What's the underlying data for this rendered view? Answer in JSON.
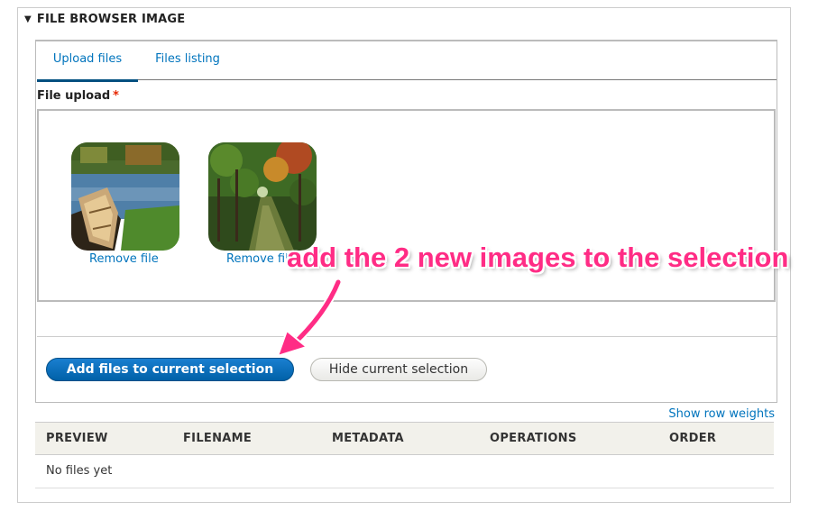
{
  "fieldset": {
    "title": "FILE BROWSER IMAGE"
  },
  "tabs": [
    {
      "label": "Upload files",
      "active": true
    },
    {
      "label": "Files listing",
      "active": false
    }
  ],
  "upload": {
    "label": "File upload",
    "required_marker": "*",
    "files": [
      {
        "thumbnail": "canoe-on-lake",
        "remove_label": "Remove file"
      },
      {
        "thumbnail": "forest-path",
        "remove_label": "Remove file"
      }
    ]
  },
  "actions": {
    "add_label": "Add files to current selection",
    "hide_label": "Hide current selection"
  },
  "table": {
    "show_row_weights": "Show row weights",
    "columns": [
      "PREVIEW",
      "FILENAME",
      "METADATA",
      "OPERATIONS",
      "ORDER"
    ],
    "empty_text": "No files yet"
  },
  "annotation": {
    "text": "add the 2 new images to the selection",
    "color": "#ff2c85"
  },
  "colors": {
    "link": "#0074bd",
    "primary_button": "#0061a8",
    "required": "#e62600"
  }
}
